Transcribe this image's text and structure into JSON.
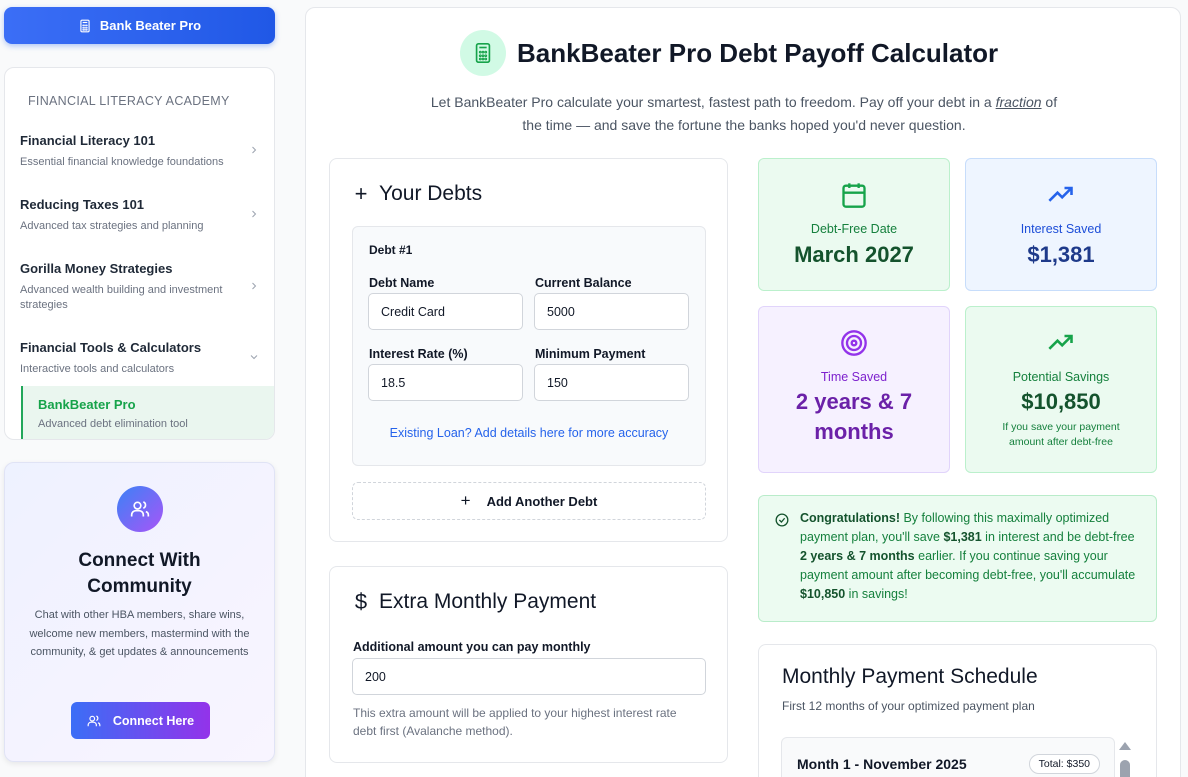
{
  "sidebar": {
    "brand_label": "Bank Beater Pro",
    "nav_heading": "FINANCIAL LITERACY ACADEMY",
    "items": [
      {
        "title": "Financial Literacy 101",
        "subtitle": "Essential financial knowledge foundations",
        "chevron": "chevron-right"
      },
      {
        "title": "Reducing Taxes 101",
        "subtitle": "Advanced tax strategies and planning",
        "chevron": "chevron-right"
      },
      {
        "title": "Gorilla Money Strategies",
        "subtitle": "Advanced wealth building and investment strategies",
        "chevron": "chevron-right"
      },
      {
        "title": "Financial Tools & Calculators",
        "subtitle": "Interactive tools and calculators",
        "chevron": "chevron-down"
      }
    ],
    "active_sub": {
      "title": "BankBeater Pro",
      "subtitle": "Advanced debt elimination tool"
    },
    "community": {
      "title": "Connect With Community",
      "description": "Chat with other HBA members, share wins, welcome new members, mastermind with the community, & get updates & announcements",
      "cta_label": "Connect Here"
    }
  },
  "header": {
    "title": "BankBeater Pro Debt Payoff Calculator",
    "subtitle_before": "Let BankBeater Pro calculate your smartest, fastest path to freedom. Pay off your debt in a ",
    "subtitle_em": "fraction",
    "subtitle_after": " of the time — and save the fortune the banks hoped you'd never question."
  },
  "debts": {
    "section_title": "Your Debts",
    "debt_label": "Debt #1",
    "fields": {
      "name_label": "Debt Name",
      "name_value": "Credit Card",
      "balance_label": "Current Balance",
      "balance_value": "5000",
      "rate_label": "Interest Rate (%)",
      "rate_value": "18.5",
      "min_label": "Minimum Payment",
      "min_value": "150"
    },
    "existing_loan_link": "Existing Loan? Add details here for more accuracy",
    "add_button": "Add Another Debt"
  },
  "extra": {
    "section_title": "Extra Monthly Payment",
    "label": "Additional amount you can pay monthly",
    "value": "200",
    "help": "This extra amount will be applied to your highest interest rate debt first (Avalanche method)."
  },
  "stats": {
    "debt_free": {
      "label": "Debt-Free Date",
      "value": "March 2027",
      "icon": "calendar-icon",
      "color": "#15803d"
    },
    "interest_saved": {
      "label": "Interest Saved",
      "value": "$1,381",
      "icon": "trending-up-icon",
      "color": "#1e40af"
    },
    "time_saved": {
      "label": "Time Saved",
      "value": "2 years & 7 months",
      "icon": "target-icon",
      "color": "#6b21a8"
    },
    "potential": {
      "label": "Potential Savings",
      "value": "$10,850",
      "note": "If you save your payment amount after debt-free",
      "icon": "trending-up-icon",
      "color": "#14532d"
    }
  },
  "congrats": {
    "lead": "Congratulations!",
    "t1": " By following this maximally optimized payment plan, you'll save ",
    "b1": "$1,381",
    "t2": " in interest and be debt-free ",
    "b2": "2 years & 7 months",
    "t3": " earlier. If you continue saving your payment amount after becoming debt-free, you'll accumulate ",
    "b3": "$10,850",
    "t4": " in savings!"
  },
  "schedule": {
    "title": "Monthly Payment Schedule",
    "subtitle": "First 12 months of your optimized payment plan",
    "month_label": "Month 1 - November 2025",
    "total_label": "Total: $350"
  }
}
